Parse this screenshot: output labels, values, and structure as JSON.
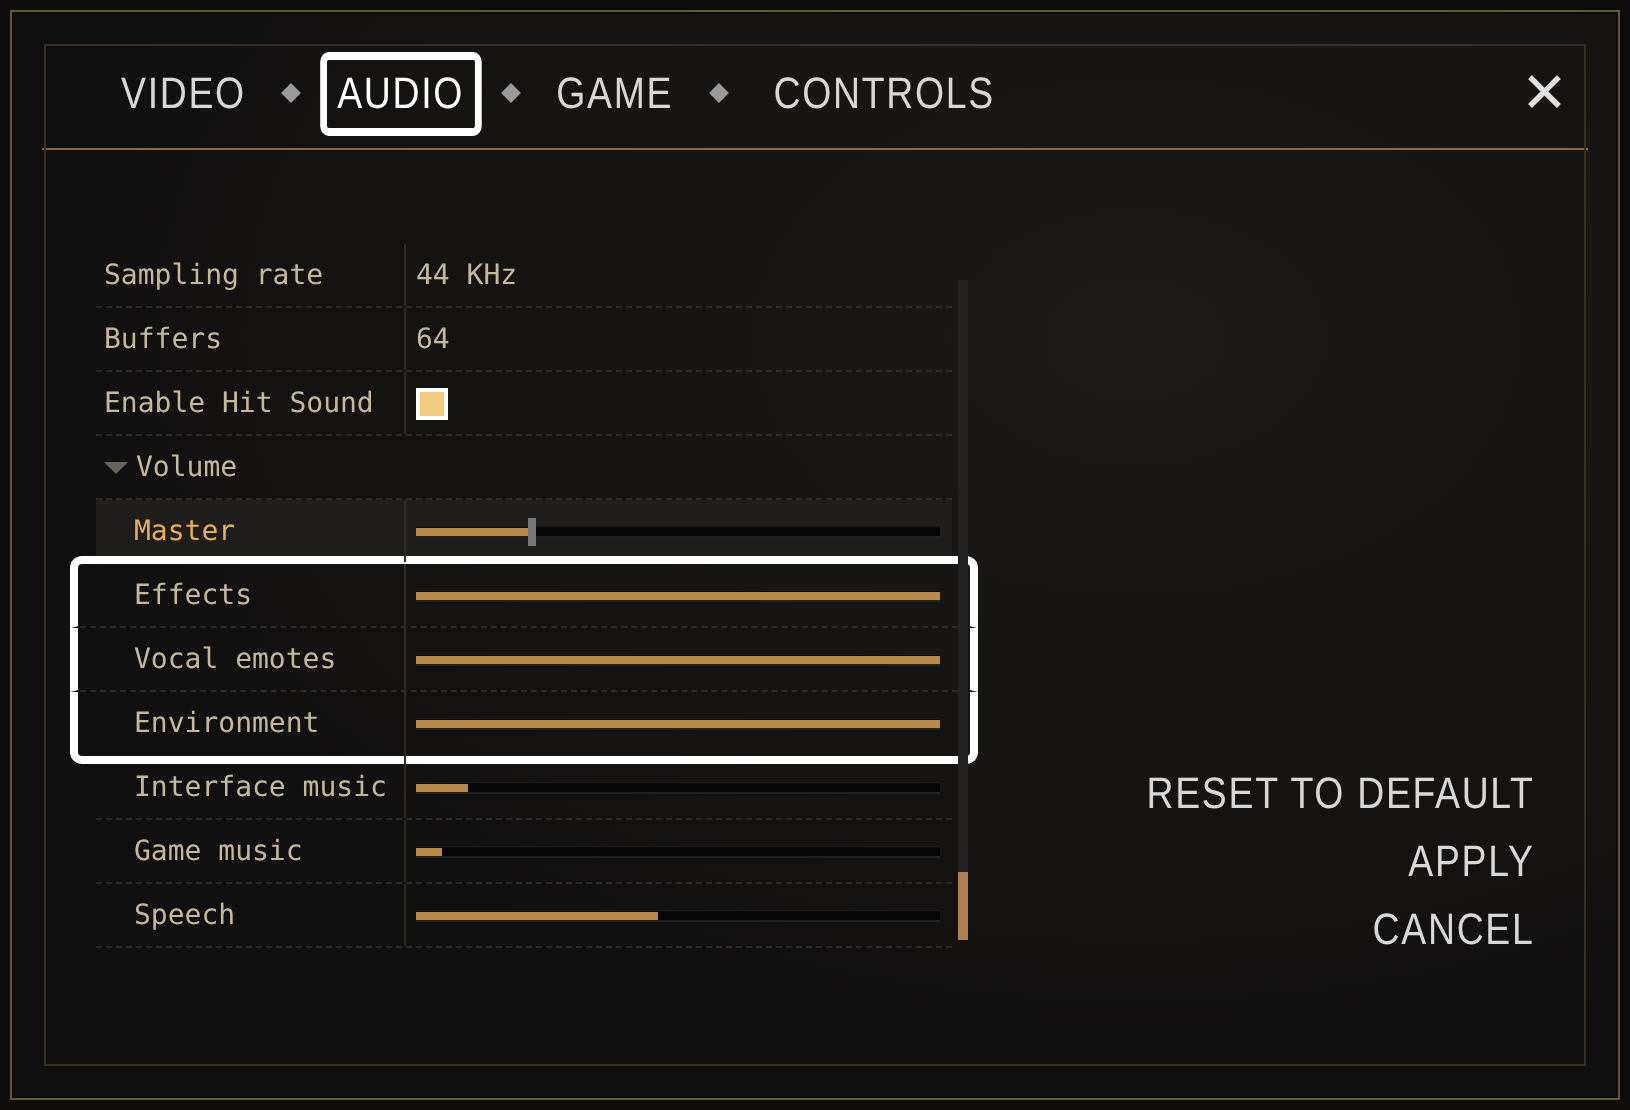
{
  "tabs": [
    {
      "label": "VIDEO",
      "selected": false
    },
    {
      "label": "AUDIO",
      "selected": true
    },
    {
      "label": "GAME",
      "selected": false
    },
    {
      "label": "CONTROLS",
      "selected": false
    }
  ],
  "close": "✕",
  "settings": [
    {
      "kind": "value",
      "label": "Sampling rate",
      "value": "44 KHz"
    },
    {
      "kind": "value",
      "label": "Buffers",
      "value": "64"
    },
    {
      "kind": "checkbox",
      "label": "Enable Hit Sound",
      "checked": true
    },
    {
      "kind": "group",
      "label": "Volume",
      "expanded": true,
      "children": [
        {
          "label": "Master",
          "level": 0.22,
          "selected": true,
          "highlighted": false
        },
        {
          "label": "Effects",
          "level": 1,
          "selected": false,
          "highlighted": true
        },
        {
          "label": "Vocal emotes",
          "level": 1,
          "selected": false,
          "highlighted": true
        },
        {
          "label": "Environment",
          "level": 1,
          "selected": false,
          "highlighted": true
        },
        {
          "label": "Interface music",
          "level": 0.1,
          "selected": false,
          "highlighted": false
        },
        {
          "label": "Game music",
          "level": 0.05,
          "selected": false,
          "highlighted": false
        },
        {
          "label": "Speech",
          "level": 0.46,
          "selected": false,
          "highlighted": false
        }
      ]
    }
  ],
  "actions": [
    "RESET TO DEFAULT",
    "APPLY",
    "CANCEL"
  ]
}
